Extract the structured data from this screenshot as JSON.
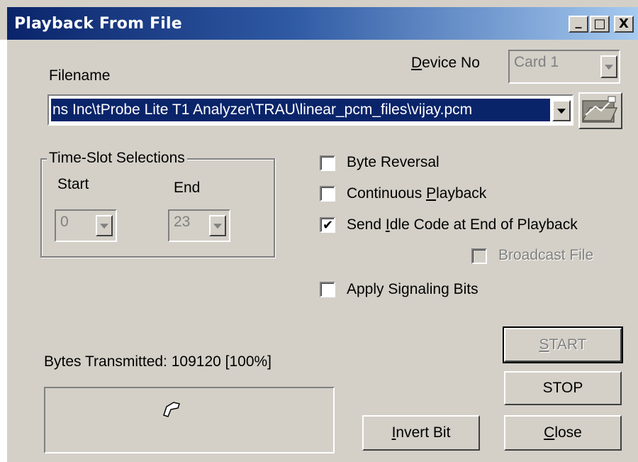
{
  "window": {
    "title": "Playback From File",
    "controls": {
      "minimize": "_",
      "maximize": "□",
      "close": "X"
    }
  },
  "device": {
    "label_prefix": "",
    "label_mnemonic": "D",
    "label_rest": "evice No",
    "selected": "Card 1"
  },
  "filename": {
    "label": "Filename",
    "value": "ns Inc\\tProbe Lite T1 Analyzer\\TRAU\\linear_pcm_files\\vijay.pcm"
  },
  "timeslot": {
    "group_label": "Time-Slot Selections",
    "start_label": "Start",
    "end_label": "End",
    "start_value": "0",
    "end_value": "23"
  },
  "options": {
    "byte_reversal": {
      "label": "Byte Reversal",
      "checked": false
    },
    "continuous": {
      "prefix": "Continuous ",
      "mnemonic": "P",
      "rest": "layback",
      "checked": false
    },
    "send_idle": {
      "prefix": "Send ",
      "mnemonic": "I",
      "rest": "dle Code at End of Playback",
      "checked": true
    },
    "broadcast": {
      "label": "Broadcast File",
      "checked": false,
      "disabled": true
    },
    "apply_signaling": {
      "label": "Apply Signaling Bits",
      "checked": false
    }
  },
  "status": {
    "bytes_transmitted": "Bytes Transmitted: 109120 [100%]"
  },
  "buttons": {
    "start": {
      "mnemonic": "S",
      "rest": "TART"
    },
    "stop": "STOP",
    "invert": {
      "mnemonic": "I",
      "rest": "nvert Bit"
    },
    "close": {
      "mnemonic": "C",
      "rest": "lose"
    }
  },
  "icons": {
    "browse": "folder-open-icon",
    "cursor": "hand-cursor-icon"
  }
}
